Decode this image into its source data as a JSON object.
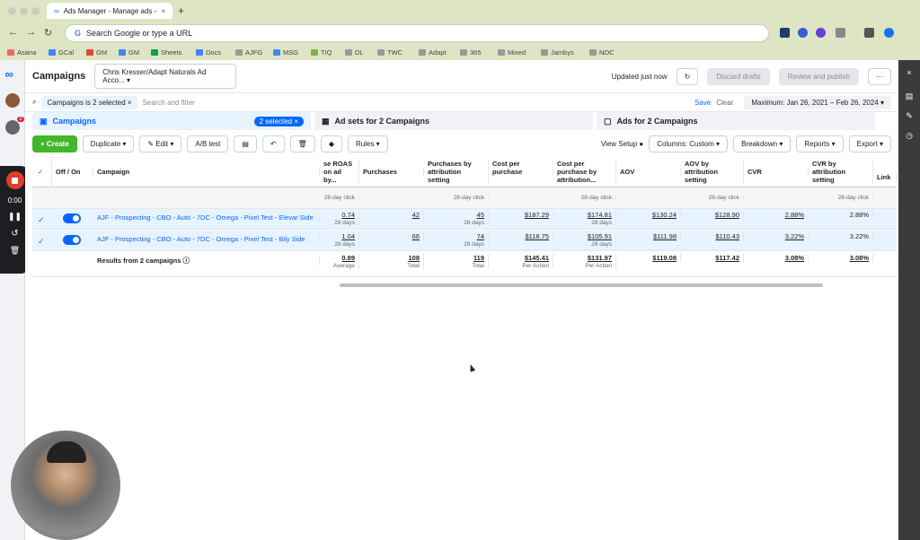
{
  "browser": {
    "tab_title": "Ads Manager - Manage ads -",
    "address": "Search Google or type a URL",
    "bookmarks": [
      "Asana",
      "GCal",
      "GM",
      "GM",
      "Sheets",
      "Docs",
      "AJFG",
      "MSG",
      "TIQ",
      "DL",
      "TWC",
      "Adapt",
      "365",
      "Mixed",
      "Jambys",
      "NOC"
    ]
  },
  "header": {
    "title": "Campaigns",
    "account": "Chris Kresser/Adapt Naturals Ad Acco...",
    "updated": "Updated just now",
    "discard": "Discard drafts",
    "review": "Review and publish"
  },
  "filter": {
    "chip": "Campaigns is 2 selected",
    "placeholder": "Search and filter",
    "save": "Save",
    "clear": "Clear",
    "date": "Maximum: Jan 26, 2021 – Feb 26, 2024"
  },
  "tabs": {
    "campaigns": "Campaigns",
    "selected": "2 selected",
    "adsets": "Ad sets for 2 Campaigns",
    "ads": "Ads for 2 Campaigns"
  },
  "toolbar": {
    "create": "+ Create",
    "duplicate": "Duplicate",
    "edit": "Edit",
    "ab": "A/B test",
    "rules": "Rules",
    "view_setup": "View Setup",
    "columns": "Columns: Custom",
    "breakdown": "Breakdown",
    "reports": "Reports",
    "export": "Export"
  },
  "recorder": {
    "time": "0:00",
    "badge": "3"
  },
  "table": {
    "headers": {
      "onoff": "Off / On",
      "campaign": "Campaign",
      "roas": "se ROAS on ad by...",
      "purchases": "Purchases",
      "pba": "Purchases by attribution setting",
      "cpp": "Cost per purchase",
      "cppba": "Cost per purchase by attribution...",
      "aov": "AOV",
      "aovba": "AOV by attribution setting",
      "cvr": "CVR",
      "cvrba": "CVR by attribution setting",
      "link": "Link"
    },
    "sub": "28-day click",
    "rows": [
      {
        "name": "AJF - Prospecting - CBO - Auto - 7DC - Omega - Pixel Test - Elevar Side",
        "roas": "0.74",
        "roas_sub": "28 days",
        "purchases": "42",
        "pba": "45",
        "pba_sub": "28 days",
        "cpp": "$187.29",
        "cppba": "$174.81",
        "cppba_sub": "28 days",
        "aov": "$130.24",
        "aovba": "$128.90",
        "cvr": "2.88%",
        "cvrba": "2.88%"
      },
      {
        "name": "AJF - Prospecting - CBO - Auto - 7DC - Omega - Pixel Test - Bily Side",
        "roas": "1.04",
        "roas_sub": "28 days",
        "purchases": "66",
        "pba": "74",
        "pba_sub": "28 days",
        "cpp": "$118.75",
        "cppba": "$105.91",
        "cppba_sub": "28 days",
        "aov": "$111.98",
        "aovba": "$110.43",
        "cvr": "3.22%",
        "cvrba": "3.22%"
      }
    ],
    "total": {
      "label": "Results from 2 campaigns",
      "roas": "0.89",
      "roas_sub": "Average",
      "purchases": "108",
      "purchases_sub": "Total",
      "pba": "119",
      "pba_sub": "Total",
      "cpp": "$145.41",
      "cpp_sub": "Per Action",
      "cppba": "$131.97",
      "cppba_sub": "Per Action",
      "aov": "$119.08",
      "aovba": "$117.42",
      "cvr": "3.08%",
      "cvrba": "3.08%"
    }
  }
}
